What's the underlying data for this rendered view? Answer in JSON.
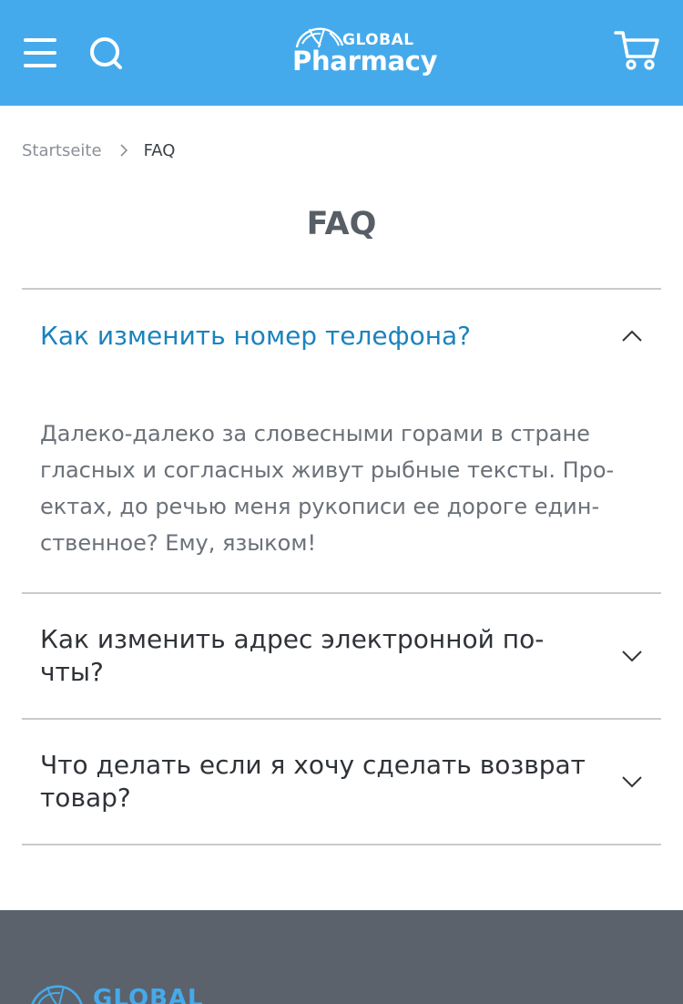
{
  "header": {
    "logo_top": "GLOBAL",
    "logo_bottom": "Pharmacy",
    "background_color": "#45aaeb",
    "icons": [
      "menu-icon",
      "search-icon",
      "cart-icon"
    ]
  },
  "breadcrumb": {
    "items": [
      {
        "label": "Startseite"
      },
      {
        "label": "FAQ"
      }
    ],
    "separator_icon": "chevron-right-icon"
  },
  "page": {
    "title": "FAQ"
  },
  "faq": {
    "items": [
      {
        "question": "Как изменить номер телефона?",
        "answer": "Далеко-далеко за словесными горами в стране гласных и согласных живут рыбные тексты. Про­ектах, до речью меня рукописи ее дороге един­ственное? Ему, языком!",
        "expanded": true,
        "icon": "chevron-up-icon"
      },
      {
        "question": "Как изменить адрес электронной по­чты?",
        "expanded": false,
        "icon": "chevron-down-icon"
      },
      {
        "question": "Что делать если я хочу сделать возврат товар?",
        "expanded": false,
        "icon": "chevron-down-icon"
      }
    ],
    "accent_color": "#1a83bf"
  },
  "footer": {
    "logo_top": "GLOBAL",
    "background_color": "#5b626b"
  }
}
